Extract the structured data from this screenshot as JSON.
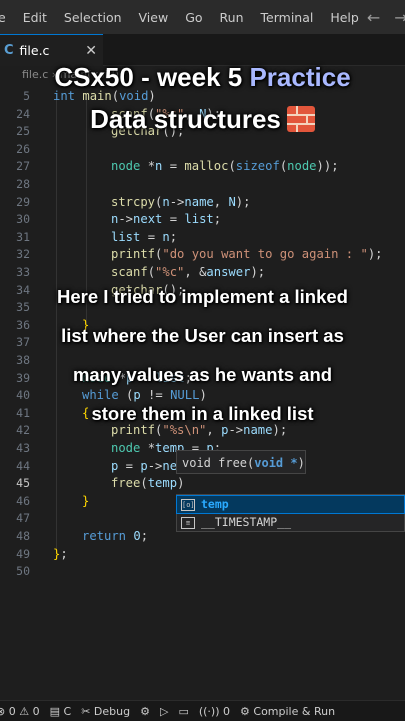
{
  "menu": [
    "e",
    "Edit",
    "Selection",
    "View",
    "Go",
    "Run",
    "Terminal",
    "Help"
  ],
  "tab": {
    "icon": "C",
    "label": "file.c",
    "close": "✕"
  },
  "breadcrumb": "file.c › main(void)",
  "editor": {
    "lines": [
      {
        "n": "5",
        "html": "<span class=\"kw\">int</span> <span class=\"fn\">main</span>(<span class=\"kw\">void</span>)",
        "indent": 0
      },
      {
        "n": "24",
        "html": "<span class=\"fn\">scanf</span>(<span class=\"str\">\"%s\"</span>, <span class=\"var\">N</span>);",
        "indent": 2
      },
      {
        "n": "25",
        "html": "<span class=\"fn\">getchar</span>();",
        "indent": 2
      },
      {
        "n": "26",
        "html": "",
        "indent": 0
      },
      {
        "n": "27",
        "html": "<span class=\"ty\">node</span> *<span class=\"var\">n</span> = <span class=\"fn\">malloc</span>(<span class=\"kw\">sizeof</span>(<span class=\"ty\">node</span>));",
        "indent": 2
      },
      {
        "n": "28",
        "html": "",
        "indent": 0
      },
      {
        "n": "29",
        "html": "<span class=\"fn\">strcpy</span>(<span class=\"var\">n</span>-><span class=\"var\">name</span>, <span class=\"var\">N</span>);",
        "indent": 2
      },
      {
        "n": "30",
        "html": "<span class=\"var\">n</span>-><span class=\"var\">next</span> = <span class=\"var\">list</span>;",
        "indent": 2
      },
      {
        "n": "31",
        "html": "<span class=\"var\">list</span> = <span class=\"var\">n</span>;",
        "indent": 2
      },
      {
        "n": "32",
        "html": "<span class=\"fn\">printf</span>(<span class=\"str\">\"do you want to go again : \"</span>);",
        "indent": 2
      },
      {
        "n": "33",
        "html": "<span class=\"fn\">scanf</span>(<span class=\"str\">\"%c\"</span>, &<span class=\"var\">answer</span>);",
        "indent": 2
      },
      {
        "n": "34",
        "html": "<span class=\"fn\">getchar</span>();",
        "indent": 2
      },
      {
        "n": "35",
        "html": "",
        "indent": 0
      },
      {
        "n": "36",
        "html": "<span class=\"br\">}</span>",
        "indent": 1
      },
      {
        "n": "37",
        "html": "",
        "indent": 0
      },
      {
        "n": "38",
        "html": "",
        "indent": 0
      },
      {
        "n": "39",
        "html": "<span class=\"ty\">node</span> *<span class=\"var\">p</span> = <span class=\"var\">list</span>;",
        "indent": 1
      },
      {
        "n": "40",
        "html": "<span class=\"kw\">while</span> (<span class=\"var\">p</span> != <span class=\"kw\">NULL</span>)",
        "indent": 1
      },
      {
        "n": "41",
        "html": "<span class=\"br\">{</span>",
        "indent": 1
      },
      {
        "n": "42",
        "html": "<span class=\"fn\">printf</span>(<span class=\"str\">\"%s\\n\"</span>, <span class=\"var\">p</span>-><span class=\"var\">name</span>);",
        "indent": 2
      },
      {
        "n": "43",
        "html": "<span class=\"ty\">node</span> *<span class=\"var\">temp</span> = <span class=\"var\">p</span>;",
        "indent": 2
      },
      {
        "n": "44",
        "html": "<span class=\"var\">p</span> = <span class=\"var\">p</span>-><span class=\"var\">next</span>;",
        "indent": 2
      },
      {
        "n": "45",
        "html": "<span class=\"fn\">free</span>(<span class=\"var\">temp</span>)",
        "indent": 2,
        "active": true
      },
      {
        "n": "46",
        "html": "<span class=\"br\">}</span>",
        "indent": 1
      },
      {
        "n": "47",
        "html": "",
        "indent": 0
      },
      {
        "n": "48",
        "html": "<span class=\"kw\">return</span> <span class=\"var\">0</span>;",
        "indent": 1
      },
      {
        "n": "49",
        "html": "<span class=\"br\">}</span>;",
        "indent": 0
      },
      {
        "n": "50",
        "html": "",
        "indent": 0
      }
    ]
  },
  "signature": {
    "name": "void free(",
    "param": "void *",
    "end": ")"
  },
  "suggestions": [
    {
      "icon": "[o]",
      "label": "temp",
      "selected": true
    },
    {
      "icon": "≡",
      "label": "__TIMESTAMP__",
      "selected": false
    }
  ],
  "overlay": {
    "title_part1": "CSx50 - week 5 ",
    "title_accent": "Practice",
    "title_line2": "Data structures",
    "body": [
      "Here I tried to implement a linked",
      "list where the User can insert as",
      "many values as he wants and",
      "store them in a linked list"
    ]
  },
  "status": {
    "errors": "0",
    "warnings": "0",
    "language": "C",
    "debug": "Debug",
    "ports": "0",
    "compile": "Compile & Run"
  },
  "colors": {
    "accent": "#0078d4",
    "brick": "#e2563b",
    "practice": "#a9b8ff"
  }
}
